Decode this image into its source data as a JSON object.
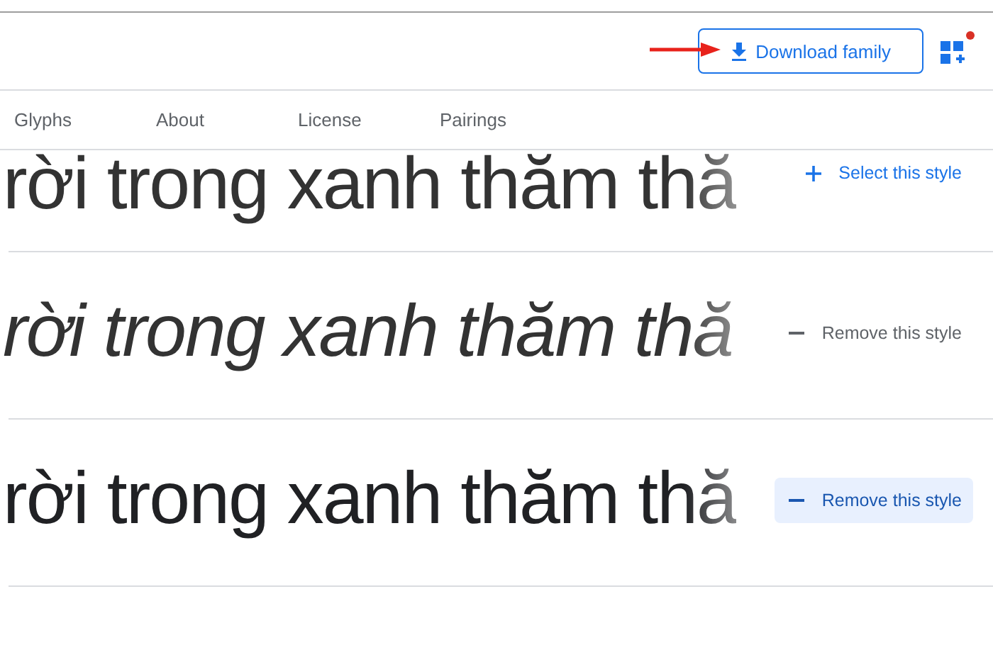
{
  "header": {
    "download_button": {
      "label": "Download family"
    },
    "family_icon": {
      "notification": true
    }
  },
  "tabs": [
    {
      "label": "Glyphs",
      "selected": false
    },
    {
      "label": "About",
      "selected": false
    },
    {
      "label": "License",
      "selected": false
    },
    {
      "label": "Pairings",
      "selected": false
    }
  ],
  "styles": [
    {
      "sample": "rời trong xanh thăm thă",
      "kind": "thin",
      "selected": false,
      "highlighted": false,
      "action": "Select this style"
    },
    {
      "sample": "rời trong xanh thăm thă",
      "kind": "thin-italic",
      "selected": true,
      "highlighted": false,
      "action": "Remove this style"
    },
    {
      "sample": "rời trong xanh thăm thă",
      "kind": "light",
      "selected": true,
      "highlighted": true,
      "action": "Remove this style"
    }
  ]
}
